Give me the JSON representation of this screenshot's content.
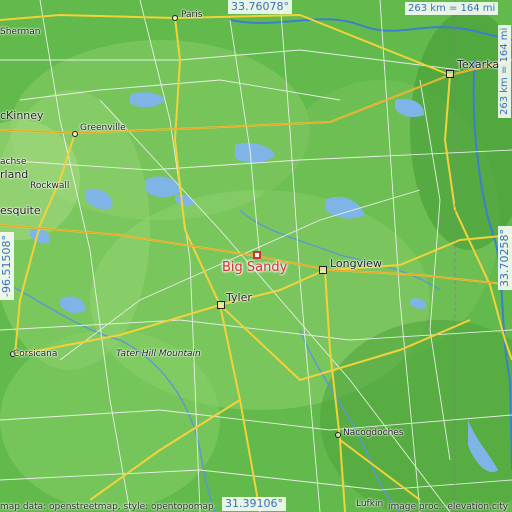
{
  "map": {
    "place_name": "Big Sandy",
    "coords": {
      "top": "33.76078°",
      "bottom": "31.39106°",
      "left": "-96.51508°",
      "right": "33.70258°"
    },
    "scale": {
      "horizontal": "263 km = 164 mi",
      "vertical": "263 km = 164 mi"
    },
    "cities": {
      "paris": "Paris",
      "sherman": "Sherman",
      "texarkana": "Texarka",
      "mckinney": "cKinney",
      "greenville": "Greenville",
      "lachse": "achse",
      "rland": "rland",
      "rockwall": "Rockwall",
      "mesquite": "esquite",
      "longview": "Longview",
      "tyler": "Tyler",
      "corsicana": "Corsicana",
      "tater_hill": "Tater Hill Mountain",
      "nacogdoches": "Nacogdoches",
      "lufkin": "Lufkin"
    },
    "footer": {
      "left": "map data: openstreetmap, style: opentopomap",
      "right": "image proc.: elevation.city"
    },
    "colors": {
      "terrain_green": "#5fb84a",
      "water": "#7fb5e6",
      "road_major": "#f2d23a",
      "road_minor": "#ffffff",
      "marker": "#d32f2f",
      "coord_text": "#3b6fb6"
    }
  }
}
